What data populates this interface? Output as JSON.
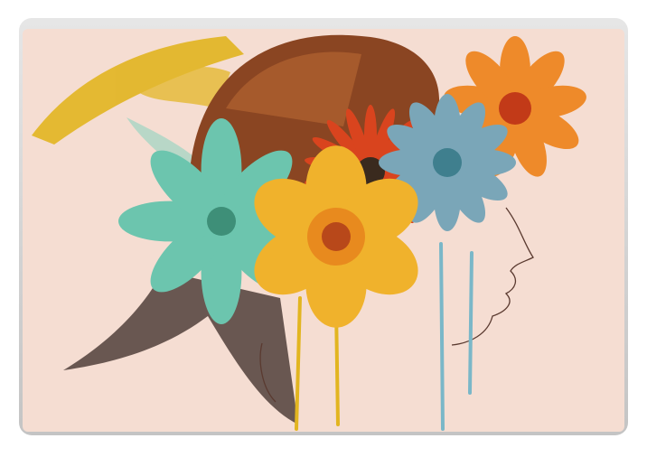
{
  "product": {
    "type": "laptop skin",
    "colors": {
      "frame": "#d8d8d8",
      "background": "#f5ddd2",
      "hair": "#7a3a1e",
      "yellow_stroke": "#e2b520",
      "teal_flower": "#6cc5ae",
      "red_flower": "#d9441e",
      "yellow_flower": "#f0b22c",
      "blue_flower": "#7aa6b8",
      "orange_flower": "#ee8a2a"
    }
  }
}
